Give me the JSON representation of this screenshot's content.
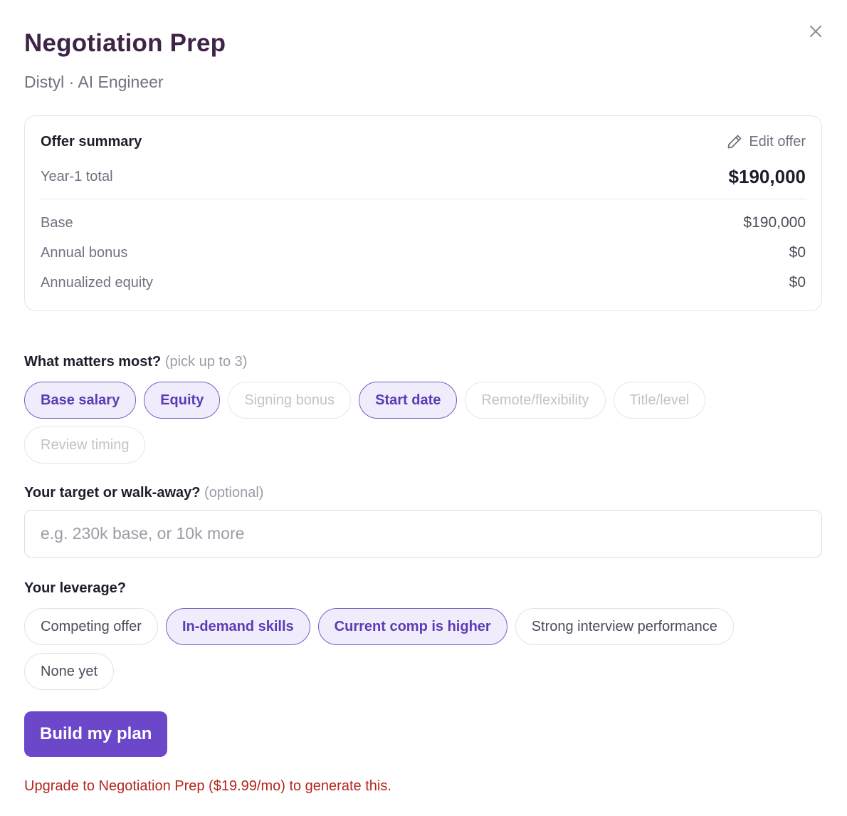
{
  "header": {
    "title": "Negotiation Prep",
    "subtitle": "Distyl · AI Engineer"
  },
  "icons": {
    "close": "close-icon",
    "edit": "pencil-icon"
  },
  "offer_summary": {
    "title": "Offer summary",
    "edit_label": "Edit offer",
    "total_label": "Year-1 total",
    "total_value": "$190,000",
    "lines": [
      {
        "label": "Base",
        "value": "$190,000"
      },
      {
        "label": "Annual bonus",
        "value": "$0"
      },
      {
        "label": "Annualized equity",
        "value": "$0"
      }
    ]
  },
  "priorities": {
    "label": "What matters most?",
    "hint": "(pick up to 3)",
    "options": [
      {
        "label": "Base salary",
        "selected": true
      },
      {
        "label": "Equity",
        "selected": true
      },
      {
        "label": "Signing bonus",
        "selected": false
      },
      {
        "label": "Start date",
        "selected": true
      },
      {
        "label": "Remote/flexibility",
        "selected": false
      },
      {
        "label": "Title/level",
        "selected": false
      },
      {
        "label": "Review timing",
        "selected": false
      }
    ]
  },
  "target": {
    "label": "Your target or walk-away?",
    "hint": "(optional)",
    "value": "",
    "placeholder": "e.g. 230k base, or 10k more"
  },
  "leverage": {
    "label": "Your leverage?",
    "options": [
      {
        "label": "Competing offer",
        "selected": false
      },
      {
        "label": "In-demand skills",
        "selected": true
      },
      {
        "label": "Current comp is higher",
        "selected": true
      },
      {
        "label": "Strong interview performance",
        "selected": false
      },
      {
        "label": "None yet",
        "selected": false
      }
    ]
  },
  "actions": {
    "build_label": "Build my plan"
  },
  "upgrade_note": "Upgrade to Negotiation Prep ($19.99/mo) to generate this.",
  "colors": {
    "title": "#3f2447",
    "accent": "#6c47c9",
    "selected_chip_bg": "#f1ecfb",
    "error": "#b3261e"
  }
}
